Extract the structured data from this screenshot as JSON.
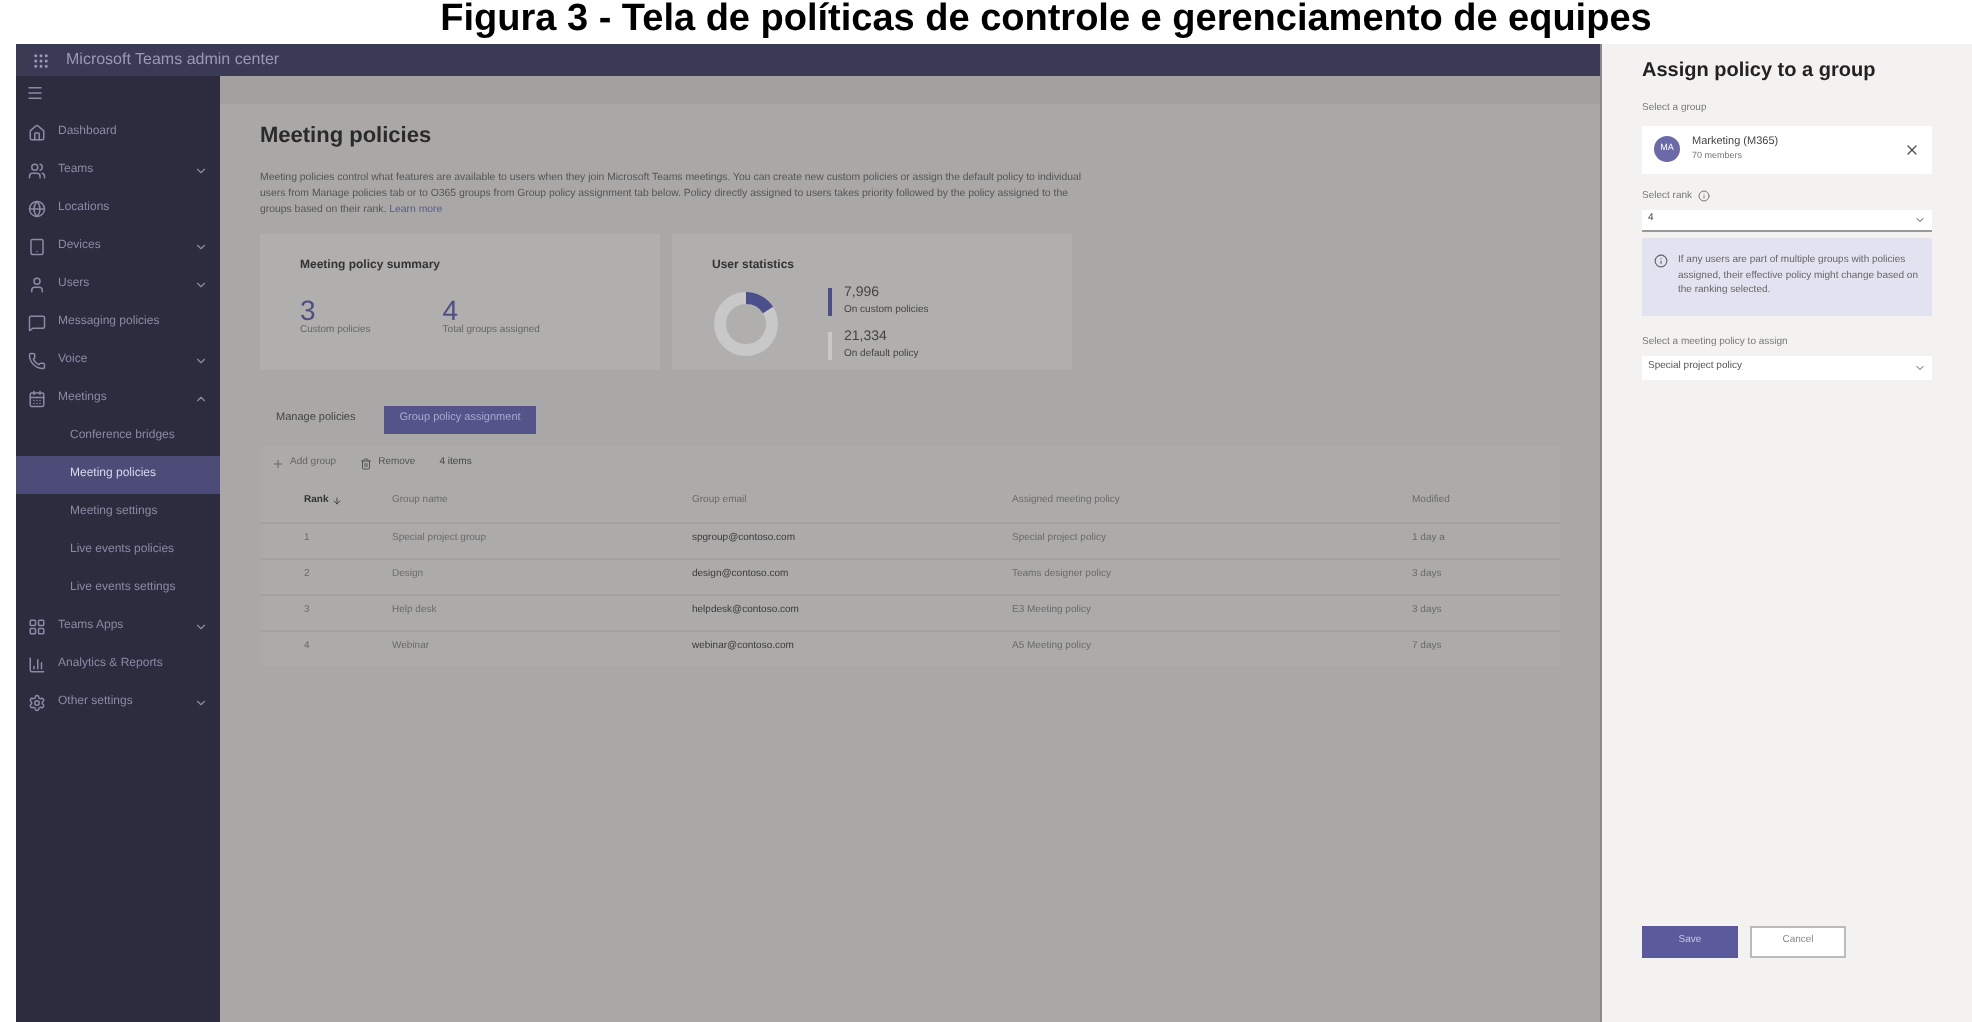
{
  "caption": "Figura 3 - Tela de políticas de controle e gerenciamento de equipes",
  "app": {
    "title": "Microsoft Teams admin center"
  },
  "sidebar": {
    "items": [
      {
        "label": "Dashboard",
        "selected": false
      },
      {
        "label": "Teams",
        "selected": false,
        "expanded": false
      },
      {
        "label": "Locations",
        "selected": false
      },
      {
        "label": "Devices",
        "selected": false,
        "expanded": false
      },
      {
        "label": "Users",
        "selected": false,
        "expanded": false
      },
      {
        "label": "Messaging policies",
        "selected": false
      },
      {
        "label": "Voice",
        "selected": false,
        "expanded": false
      },
      {
        "label": "Meetings",
        "selected": false,
        "expanded": true,
        "children": [
          {
            "label": "Conference bridges",
            "selected": false
          },
          {
            "label": "Meeting policies",
            "selected": true
          },
          {
            "label": "Meeting settings",
            "selected": false
          },
          {
            "label": "Live events policies",
            "selected": false
          },
          {
            "label": "Live events settings",
            "selected": false
          }
        ]
      },
      {
        "label": "Teams Apps",
        "selected": false,
        "expanded": false
      },
      {
        "label": "Analytics & Reports",
        "selected": false
      },
      {
        "label": "Other settings",
        "selected": false,
        "expanded": false
      }
    ]
  },
  "page": {
    "title": "Meeting policies",
    "description": "Meeting policies control what features are available to users when they join Microsoft Teams meetings. You can create new custom policies or assign the default policy to individual users from Manage policies tab or to O365 groups from Group policy assignment tab below. Policy directly assigned to users takes priority followed by the policy assigned to the groups based on their rank.",
    "learn_more": "Learn more",
    "summary": {
      "title": "Meeting policy summary",
      "stats": [
        {
          "value": "3",
          "label": "Custom policies"
        },
        {
          "value": "4",
          "label": "Total groups assigned"
        }
      ]
    },
    "user_statistics": {
      "title": "User statistics",
      "stats": [
        {
          "value": "7,996",
          "label": "On custom policies",
          "color": "#4b4f8c"
        },
        {
          "value": "21,334",
          "label": "On default policy",
          "color": "#c8c8c8"
        }
      ]
    },
    "tabs": [
      {
        "label": "Manage policies",
        "selected": false
      },
      {
        "label": "Group policy assignment",
        "selected": true
      }
    ],
    "toolbar": {
      "add": "Add group",
      "remove": "Remove",
      "count": "4 items"
    },
    "table": {
      "columns": [
        "Rank",
        "Group name",
        "Group email",
        "Assigned meeting policy",
        "Modified"
      ],
      "rows": [
        [
          "1",
          "Special project group",
          "spgroup@contoso.com",
          "Special project policy",
          "1 day a"
        ],
        [
          "2",
          "Design",
          "design@contoso.com",
          "Teams designer policy",
          "3 days"
        ],
        [
          "3",
          "Help desk",
          "helpdesk@contoso.com",
          "E3 Meeting policy",
          "3 days"
        ],
        [
          "4",
          "Webinar",
          "webinar@contoso.com",
          "A5 Meeting policy",
          "7 days"
        ]
      ]
    }
  },
  "panel": {
    "title": "Assign policy to a group",
    "group_label": "Select a group",
    "group_initials": "MA",
    "group_name": "Marketing (M365)",
    "group_members": "70 members",
    "rank_label": "Select rank",
    "rank_value": "4",
    "info": "If any users are part of multiple groups with policies assigned, their effective policy might change based on the ranking selected.",
    "policy_label": "Select a meeting policy to assign",
    "policy_value": "Special project policy",
    "save": "Save",
    "cancel": "Cancel"
  }
}
